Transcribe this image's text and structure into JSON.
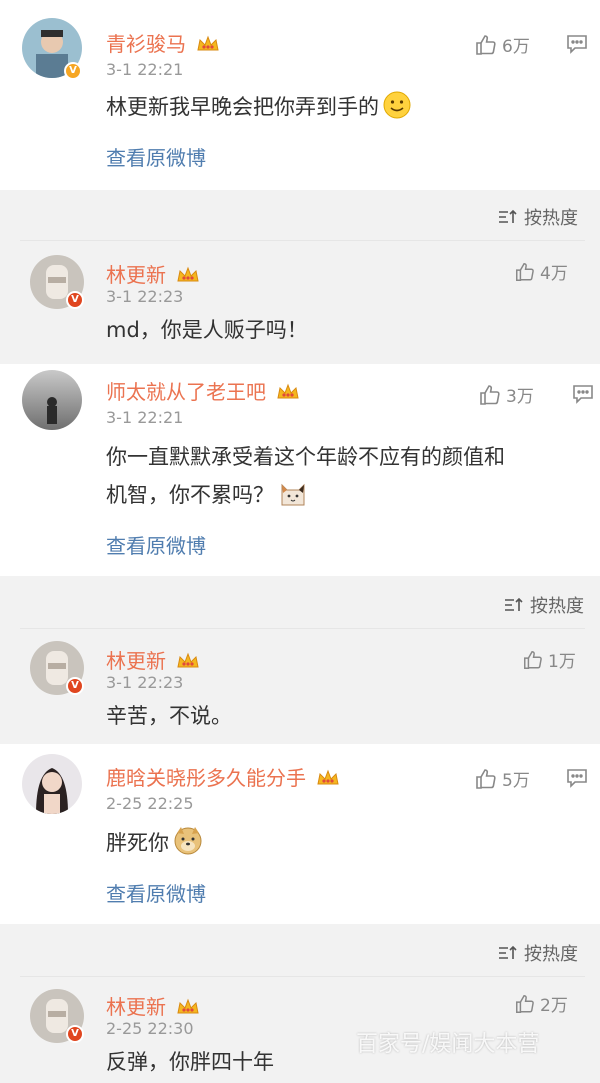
{
  "comments": [
    {
      "user": "青衫骏马",
      "time": "3-1 22:21",
      "likes": "6万",
      "text": "林更新我早晚会把你弄到手的",
      "link": "查看原微博",
      "badge": "V",
      "sort": "按热度",
      "reply": {
        "user": "林更新",
        "time": "3-1 22:23",
        "likes": "4万",
        "text": "md，你是人贩子吗！",
        "badge": "V"
      }
    },
    {
      "user": "师太就从了老王吧",
      "time": "3-1 22:21",
      "likes": "3万",
      "text_line1": "你一直默默承受着这个年龄不应有的颜值和",
      "text_line2": "机智，你不累吗？",
      "link": "查看原微博",
      "sort": "按热度",
      "reply": {
        "user": "林更新",
        "time": "3-1 22:23",
        "likes": "1万",
        "text": "辛苦，不说。",
        "badge": "V"
      }
    },
    {
      "user": "鹿晗关晓彤多久能分手",
      "time": "2-25 22:25",
      "likes": "5万",
      "text": "胖死你",
      "link": "查看原微博",
      "sort": "按热度",
      "reply": {
        "user": "林更新",
        "time": "2-25 22:30",
        "likes": "2万",
        "text": "反弹，你胖四十年",
        "badge": "V"
      }
    }
  ],
  "watermark": "百家号/娱闻大本营",
  "colors": {
    "name": "#eb7350",
    "link": "#507daf",
    "time": "#999999",
    "badge_red": "#e0461f",
    "badge_gold": "#f6a623"
  }
}
